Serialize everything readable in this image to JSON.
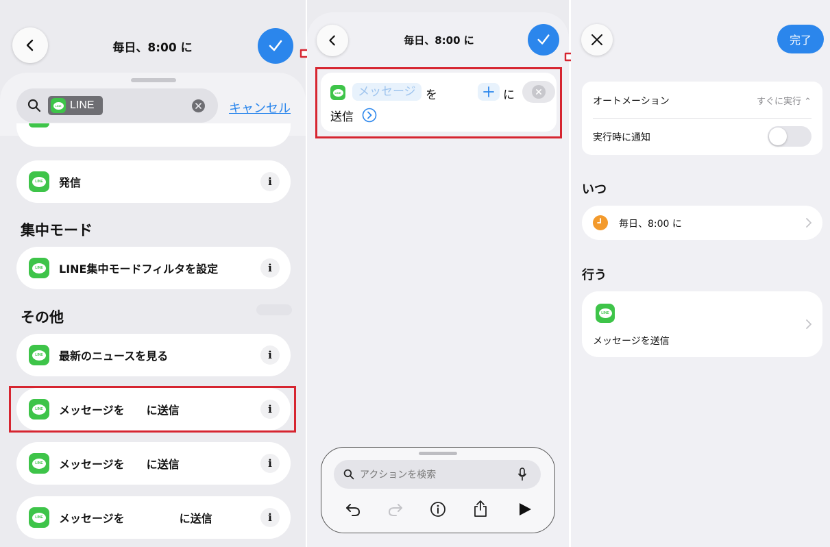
{
  "colors": {
    "accent": "#2b86ec",
    "line_green": "#3ec449",
    "highlight": "#d62530",
    "orange": "#f39a2c"
  },
  "left_panel": {
    "title": "毎日、8:00 に",
    "search": {
      "token": "LINE",
      "cancel": "キャンセル"
    },
    "rows": [
      {
        "label": "発信"
      },
      {
        "section": "集中モード"
      },
      {
        "label": "LINE集中モードフィルタを設定"
      },
      {
        "section": "その他"
      },
      {
        "label": "最新のニュースを見る"
      },
      {
        "label": "メッセージを　　に送信",
        "highlighted": true
      },
      {
        "label": "メッセージを　　に送信"
      },
      {
        "label": "メッセージを　　　　　に送信"
      }
    ],
    "line_icon_text": "LINE"
  },
  "middle_panel": {
    "title": "毎日、8:00 に",
    "action": {
      "param": "メッセージ",
      "wo": "を",
      "ni": "に",
      "send": "送信"
    },
    "dock": {
      "search_placeholder": "アクションを検索"
    }
  },
  "right_panel": {
    "done": "完了",
    "settings": [
      {
        "label": "オートメーション",
        "value": "すぐに実行 ⌃"
      },
      {
        "label": "実行時に通知",
        "toggle": false
      }
    ],
    "when_header": "いつ",
    "when_value": "毎日、8:00 に",
    "do_header": "行う",
    "do_action": "メッセージを送信"
  }
}
